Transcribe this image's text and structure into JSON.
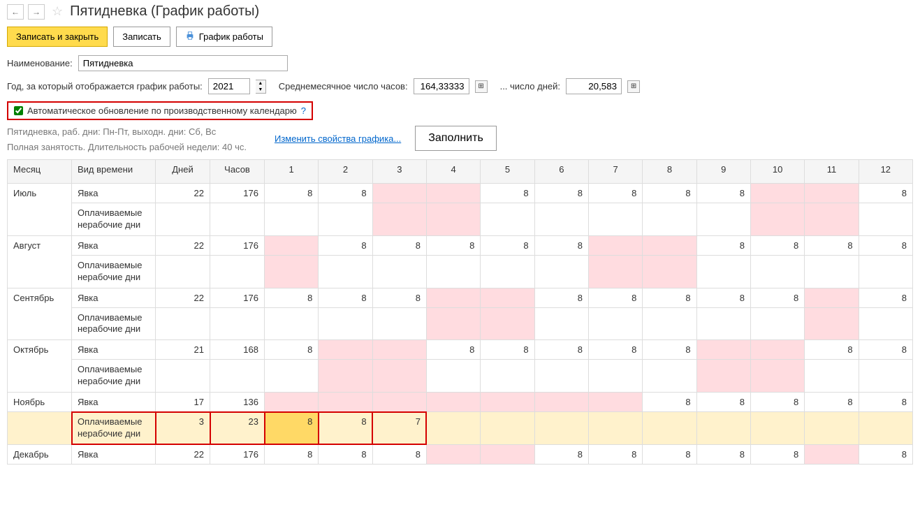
{
  "header": {
    "title": "Пятидневка (График работы)"
  },
  "actions": {
    "save_close": "Записать и закрыть",
    "save": "Записать",
    "schedule": "График работы"
  },
  "form": {
    "name_label": "Наименование:",
    "name_value": "Пятидневка",
    "year_label": "Год, за который отображается график работы:",
    "year_value": "2021",
    "avg_hours_label": "Среднемесячное число часов:",
    "avg_hours_value": "164,33333",
    "avg_days_label": "... число дней:",
    "avg_days_value": "20,583",
    "auto_update_label": "Автоматическое обновление по производственному календарю",
    "help": "?"
  },
  "info": {
    "line1": "Пятидневка, раб. дни: Пн-Пт, выходн. дни: Сб, Вс",
    "line2": "Полная занятость. Длительность рабочей недели: 40 чс.",
    "change_link": "Изменить свойства графика...",
    "fill_button": "Заполнить"
  },
  "table": {
    "headers": {
      "month": "Месяц",
      "type": "Вид времени",
      "days": "Дней",
      "hours": "Часов"
    },
    "day_cols": [
      "1",
      "2",
      "3",
      "4",
      "5",
      "6",
      "7",
      "8",
      "9",
      "10",
      "11",
      "12"
    ],
    "type_attendance": "Явка",
    "type_paid_nonwork": "Оплачиваемые нерабочие дни",
    "rows": [
      {
        "month": "Июль",
        "days": "22",
        "hours": "176",
        "cells": [
          "8",
          "8",
          "",
          "",
          "8",
          "8",
          "8",
          "8",
          "8",
          "",
          "",
          "8"
        ],
        "pink": [
          3,
          4,
          10,
          11
        ]
      },
      {
        "month": "Август",
        "days": "22",
        "hours": "176",
        "cells": [
          "",
          "8",
          "8",
          "8",
          "8",
          "8",
          "",
          "",
          "8",
          "8",
          "8",
          "8"
        ],
        "pink": [
          1,
          7,
          8
        ]
      },
      {
        "month": "Сентябрь",
        "days": "22",
        "hours": "176",
        "cells": [
          "8",
          "8",
          "8",
          "",
          "",
          "8",
          "8",
          "8",
          "8",
          "8",
          "",
          "8"
        ],
        "pink": [
          4,
          5,
          11
        ]
      },
      {
        "month": "Октябрь",
        "days": "21",
        "hours": "168",
        "cells": [
          "8",
          "",
          "",
          "8",
          "8",
          "8",
          "8",
          "8",
          "",
          "",
          "8",
          "8"
        ],
        "pink": [
          2,
          3,
          9,
          10
        ]
      },
      {
        "month": "Ноябрь",
        "days": "17",
        "hours": "136",
        "cells": [
          "",
          "",
          "",
          "",
          "",
          "",
          "",
          "8",
          "8",
          "8",
          "8",
          "8"
        ],
        "pink": [
          1,
          2,
          3,
          4,
          5,
          6,
          7
        ]
      },
      {
        "month": "Декабрь",
        "days": "22",
        "hours": "176",
        "cells": [
          "8",
          "8",
          "8",
          "",
          "",
          "8",
          "8",
          "8",
          "8",
          "8",
          "",
          "8"
        ],
        "pink": [
          4,
          5,
          11
        ]
      }
    ],
    "nov_paid": {
      "days": "3",
      "hours": "23",
      "cells": [
        "8",
        "8",
        "7",
        "",
        "",
        "",
        "",
        "",
        "",
        "",
        "",
        ""
      ]
    }
  }
}
